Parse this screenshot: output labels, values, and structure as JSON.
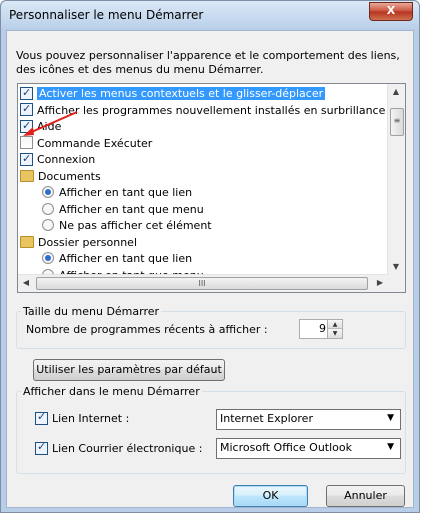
{
  "window": {
    "title": "Personnaliser le menu Démarrer",
    "close_label": "X"
  },
  "description": "Vous pouvez personnaliser l'apparence et le comportement des liens, des icônes et des menus du menu Démarrer.",
  "list": {
    "items": [
      {
        "type": "checkbox",
        "checked": true,
        "label": "Activer les menus contextuels et le glisser-déplacer",
        "selected": true
      },
      {
        "type": "checkbox",
        "checked": true,
        "label": "Afficher les programmes nouvellement installés en surbrillance"
      },
      {
        "type": "checkbox",
        "checked": true,
        "label": "Aide"
      },
      {
        "type": "checkbox",
        "checked": false,
        "label": "Commande Exécuter"
      },
      {
        "type": "checkbox",
        "checked": true,
        "label": "Connexion"
      },
      {
        "type": "folder",
        "label": "Documents"
      },
      {
        "type": "radio",
        "checked": true,
        "label": "Afficher en tant que lien"
      },
      {
        "type": "radio",
        "checked": false,
        "label": "Afficher en tant que menu"
      },
      {
        "type": "radio",
        "checked": false,
        "label": "Ne pas afficher cet élément"
      },
      {
        "type": "folder",
        "label": "Dossier personnel"
      },
      {
        "type": "radio",
        "checked": true,
        "label": "Afficher en tant que lien"
      },
      {
        "type": "radio",
        "checked": false,
        "label": "Afficher en tant que menu"
      }
    ],
    "hscroll_grip": "III"
  },
  "size_group": {
    "title": "Taille du menu Démarrer",
    "recent_label": "Nombre de programmes récents à afficher :",
    "recent_value": "9"
  },
  "defaults_button": "Utiliser les paramètres par défaut",
  "show_group": {
    "title": "Afficher dans le menu Démarrer",
    "internet_label": "Lien Internet :",
    "internet_checked": true,
    "internet_value": "Internet Explorer",
    "mail_label": "Lien Courrier électronique :",
    "mail_checked": true,
    "mail_value": "Microsoft Office Outlook"
  },
  "buttons": {
    "ok": "OK",
    "cancel": "Annuler"
  },
  "colors": {
    "selection": "#3399ff",
    "annotation_arrow": "#e0201b"
  },
  "icons": {
    "close": "close-icon",
    "folder": "folder-icon",
    "scroll_up": "scroll-up-icon",
    "scroll_down": "scroll-down-icon"
  }
}
